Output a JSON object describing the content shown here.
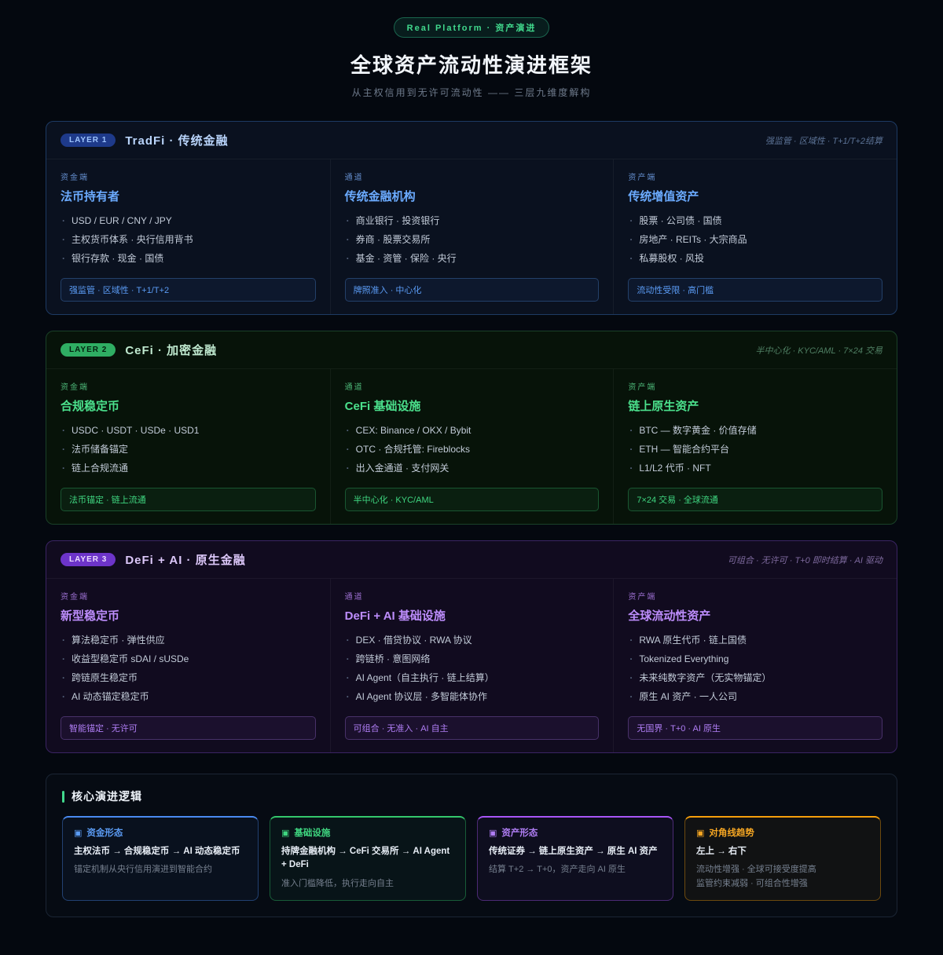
{
  "header": {
    "badge": "Real Platform · 资产演进",
    "title": "全球资产流动性演进框架",
    "subtitle": "从主权信用到无许可流动性 —— 三层九维度解构"
  },
  "accent_colors": {
    "layer1": "#5b9cf5",
    "layer2": "#3fd680",
    "layer3": "#b07ef5",
    "trend": "#f5a623"
  },
  "layers": [
    {
      "badge": "LAYER 1",
      "title": "TradFi · 传统金融",
      "meta": "强监管 · 区域性 · T+1/T+2结算",
      "columns": [
        {
          "kicker": "资金端",
          "title": "法币持有者",
          "items": [
            "USD / EUR / CNY / JPY",
            "主权货币体系 · 央行信用背书",
            "银行存款 · 现金 · 国债"
          ],
          "tag": "强监管 · 区域性 · T+1/T+2"
        },
        {
          "kicker": "通道",
          "title": "传统金融机构",
          "items": [
            "商业银行 · 投资银行",
            "券商 · 股票交易所",
            "基金 · 资管 · 保险 · 央行"
          ],
          "tag": "牌照准入 · 中心化"
        },
        {
          "kicker": "资产端",
          "title": "传统增值资产",
          "items": [
            "股票 · 公司债 · 国债",
            "房地产 · REITs · 大宗商品",
            "私募股权 · 风投"
          ],
          "tag": "流动性受限 · 高门槛"
        }
      ]
    },
    {
      "badge": "LAYER 2",
      "title": "CeFi · 加密金融",
      "meta": "半中心化 · KYC/AML · 7×24 交易",
      "columns": [
        {
          "kicker": "资金端",
          "title": "合规稳定币",
          "items": [
            "USDC · USDT · USDe · USD1",
            "法币储备锚定",
            "链上合规流通"
          ],
          "tag": "法币锚定 · 链上流通"
        },
        {
          "kicker": "通道",
          "title": "CeFi 基础设施",
          "items": [
            "CEX: Binance / OKX / Bybit",
            "OTC · 合规托管: Fireblocks",
            "出入金通道 · 支付网关"
          ],
          "tag": "半中心化 · KYC/AML"
        },
        {
          "kicker": "资产端",
          "title": "链上原生资产",
          "items": [
            "BTC — 数字黄金 · 价值存储",
            "ETH — 智能合约平台",
            "L1/L2 代币 · NFT"
          ],
          "tag": "7×24 交易 · 全球流通"
        }
      ]
    },
    {
      "badge": "LAYER 3",
      "title": "DeFi + AI · 原生金融",
      "meta": "可组合 · 无许可 · T+0 即时结算 · AI 驱动",
      "columns": [
        {
          "kicker": "资金端",
          "title": "新型稳定币",
          "items": [
            "算法稳定币 · 弹性供应",
            "收益型稳定币 sDAI / sUSDe",
            "跨链原生稳定币",
            "AI 动态锚定稳定币"
          ],
          "tag": "智能锚定 · 无许可"
        },
        {
          "kicker": "通道",
          "title": "DeFi + AI 基础设施",
          "items": [
            "DEX · 借贷协议 · RWA 协议",
            "跨链桥 · 意图网络",
            "AI Agent（自主执行 · 链上结算）",
            "AI Agent 协议层 · 多智能体协作"
          ],
          "tag": "可组合 · 无准入 · AI 自主"
        },
        {
          "kicker": "资产端",
          "title": "全球流动性资产",
          "items": [
            "RWA 原生代币 · 链上国债",
            "Tokenized Everything",
            "未来纯数字资产（无实物锚定）",
            "原生 AI 资产 · 一人公司"
          ],
          "tag": "无国界 · T+0 · AI 原生"
        }
      ]
    }
  ],
  "logic": {
    "title": "核心演进逻辑",
    "cards": [
      {
        "icon": "▣",
        "title": "资金形态",
        "headline": "主权法币 → 合规稳定币 → AI 动态稳定币",
        "notes": [
          "锚定机制从央行信用演进到智能合约"
        ]
      },
      {
        "icon": "▣",
        "title": "基础设施",
        "headline": "持牌金融机构 → CeFi 交易所 → AI Agent + DeFi",
        "notes": [
          "准入门槛降低，执行走向自主"
        ]
      },
      {
        "icon": "▣",
        "title": "资产形态",
        "headline": "传统证券 → 链上原生资产 → 原生 AI 资产",
        "notes": [
          "结算 T+2 → T+0，资产走向 AI 原生"
        ]
      },
      {
        "icon": "▣",
        "title": "对角线趋势",
        "headline": "左上 → 右下",
        "notes": [
          "流动性增强 · 全球可接受度提高",
          "监管约束减弱 · 可组合性增强"
        ]
      }
    ]
  }
}
